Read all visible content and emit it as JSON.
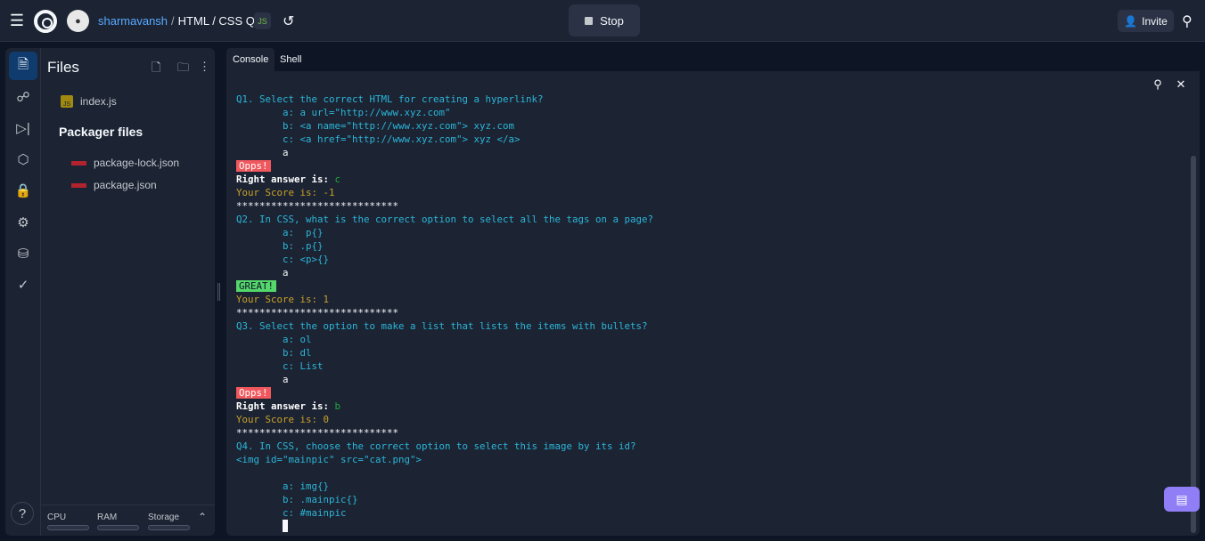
{
  "topbar": {
    "owner": "sharmavansh",
    "separator": "/",
    "repl_name": "HTML / CSS Quiz",
    "stop_label": "Stop",
    "invite_label": "Invite"
  },
  "files": {
    "title": "Files",
    "items": [
      {
        "name": "index.js",
        "icon": "js-icon"
      }
    ],
    "packager_title": "Packager files",
    "packager_items": [
      {
        "name": "package-lock.json",
        "icon": "npm-icon"
      },
      {
        "name": "package.json",
        "icon": "npm-icon"
      }
    ],
    "resources": {
      "cpu": "CPU",
      "ram": "RAM",
      "storage": "Storage"
    }
  },
  "tabs": [
    {
      "label": "Console",
      "active": true
    },
    {
      "label": "Shell",
      "active": false
    }
  ],
  "console": {
    "lines": [
      {
        "text": "Q1. Select the correct HTML for creating a hyperlink?",
        "style": "q"
      },
      {
        "text": "        a: a url=\"http://www.xyz.com\"",
        "style": "q"
      },
      {
        "text": "        b: <a name=\"http://www.xyz.com\"> xyz.com",
        "style": "q"
      },
      {
        "text": "        c: <a href=\"http://www.xyz.com\"> xyz </a>",
        "style": "q"
      },
      {
        "text": "        a",
        "style": "w"
      },
      {
        "text": "Opps!",
        "style": "bad"
      },
      {
        "label": "Right answer is: ",
        "value": "c",
        "style": "answer"
      },
      {
        "text": "Your Score is: -1",
        "style": "y"
      },
      {
        "text": "****************************",
        "style": "w"
      },
      {
        "text": "Q2. In CSS, what is the correct option to select all the tags on a page?",
        "style": "q"
      },
      {
        "text": "        a:  p{}",
        "style": "q"
      },
      {
        "text": "        b: .p{}",
        "style": "q"
      },
      {
        "text": "        c: <p>{}",
        "style": "q"
      },
      {
        "text": "        a",
        "style": "w"
      },
      {
        "text": "GREAT!",
        "style": "good"
      },
      {
        "text": "Your Score is: 1",
        "style": "y"
      },
      {
        "text": "****************************",
        "style": "w"
      },
      {
        "text": "Q3. Select the option to make a list that lists the items with bullets?",
        "style": "q"
      },
      {
        "text": "        a: ol",
        "style": "q"
      },
      {
        "text": "        b: dl",
        "style": "q"
      },
      {
        "text": "        c: List",
        "style": "q"
      },
      {
        "text": "        a",
        "style": "w"
      },
      {
        "text": "Opps!",
        "style": "bad"
      },
      {
        "label": "Right answer is: ",
        "value": "b",
        "style": "answer"
      },
      {
        "text": "Your Score is: 0",
        "style": "y"
      },
      {
        "text": "****************************",
        "style": "w"
      },
      {
        "text": "Q4. In CSS, choose the correct option to select this image by its id?",
        "style": "q"
      },
      {
        "text": "<img id=\"mainpic\" src=\"cat.png\">",
        "style": "q"
      },
      {
        "text": "",
        "style": "q"
      },
      {
        "text": "        a: img{}",
        "style": "q"
      },
      {
        "text": "        b: .mainpic{}",
        "style": "q"
      },
      {
        "text": "        c: #mainpic",
        "style": "q"
      }
    ]
  }
}
